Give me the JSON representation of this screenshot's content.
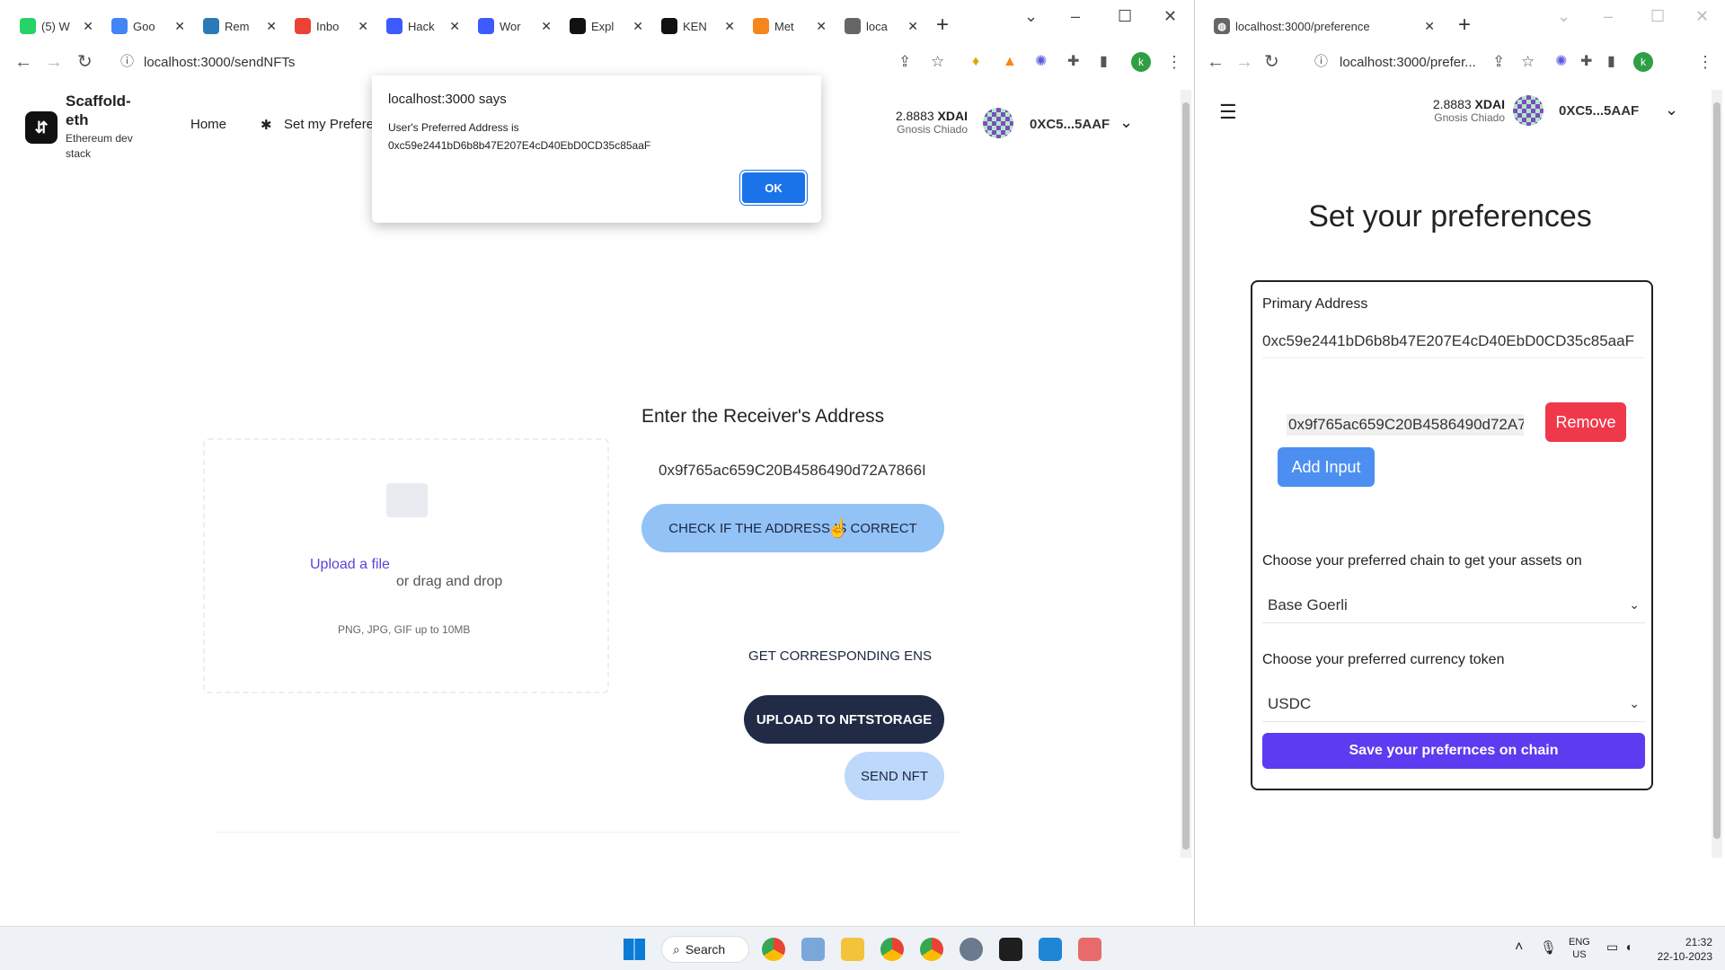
{
  "left_window": {
    "tabs": [
      {
        "label": "(5) W",
        "icon": "whatsapp-icon",
        "color": "#25d366"
      },
      {
        "label": "Goo",
        "icon": "google-docs-icon",
        "color": "#4285f4"
      },
      {
        "label": "Rem",
        "icon": "remix-icon",
        "color": "#2a7ab8"
      },
      {
        "label": "Inbo",
        "icon": "gmail-icon",
        "color": "#ea4335"
      },
      {
        "label": "Hack",
        "icon": "hackathon-icon",
        "color": "#3d5afe"
      },
      {
        "label": "Wor",
        "icon": "workspace-icon",
        "color": "#3d5afe"
      },
      {
        "label": "Expl",
        "icon": "x-icon",
        "color": "#111111"
      },
      {
        "label": "KEN",
        "icon": "github-icon",
        "color": "#111111"
      },
      {
        "label": "Met",
        "icon": "metamask-icon",
        "color": "#f6851b"
      },
      {
        "label": "loca",
        "icon": "globe-icon",
        "color": "#666666"
      }
    ],
    "url": "localhost:3000/sendNFTs",
    "brand": {
      "name_line1": "Scaffold-",
      "name_line2": "eth",
      "tagline_line1": "Ethereum dev",
      "tagline_line2": "stack"
    },
    "nav": {
      "home": "Home",
      "set_pref": "Set my Prefere"
    },
    "balance": {
      "amount": "2.8883",
      "currency": "XDAI",
      "network": "Gnosis Chiado"
    },
    "account": "0XC5...5AAF",
    "dialog": {
      "title": "localhost:3000 says",
      "message_line1": "User's Preferred Address is",
      "message_line2": "0xc59e2441bD6b8b47E207E4cD40EbD0CD35c85aaF",
      "ok": "OK"
    },
    "upload": {
      "link": "Upload a file",
      "drag": "or drag and drop",
      "hint": "PNG, JPG, GIF up to 10MB"
    },
    "receiver": {
      "heading": "Enter the Receiver's Address",
      "value": "0x9f765ac659C20B4586490d72A7866I",
      "check_btn": "CHECK IF THE ADDRESS IS CORRECT",
      "ens_btn": "GET CORRESPONDING ENS",
      "upload_btn": "UPLOAD TO NFTSTORAGE",
      "send_btn": "SEND NFT"
    }
  },
  "right_window": {
    "tab_label": "localhost:3000/preference",
    "url": "localhost:3000/prefer...",
    "balance": {
      "amount": "2.8883",
      "currency": "XDAI",
      "network": "Gnosis Chiado"
    },
    "account": "0XC5...5AAF",
    "title": "Set your preferences",
    "primary_label": "Primary Address",
    "primary_value": "0xc59e2441bD6b8b47E207E4cD40EbD0CD35c85aaF",
    "secondary_value": "0x9f765ac659C20B4586490d72A7",
    "remove": "Remove",
    "add_input": "Add Input",
    "chain_label": "Choose your preferred chain to get your assets on",
    "chain_value": "Base Goerli",
    "token_label": "Choose your preferred currency token",
    "token_value": "USDC",
    "save": "Save your prefernces on chain"
  },
  "taskbar": {
    "search": "Search",
    "lang_line1": "ENG",
    "lang_line2": "US",
    "time": "21:32",
    "date": "22-10-2023"
  }
}
